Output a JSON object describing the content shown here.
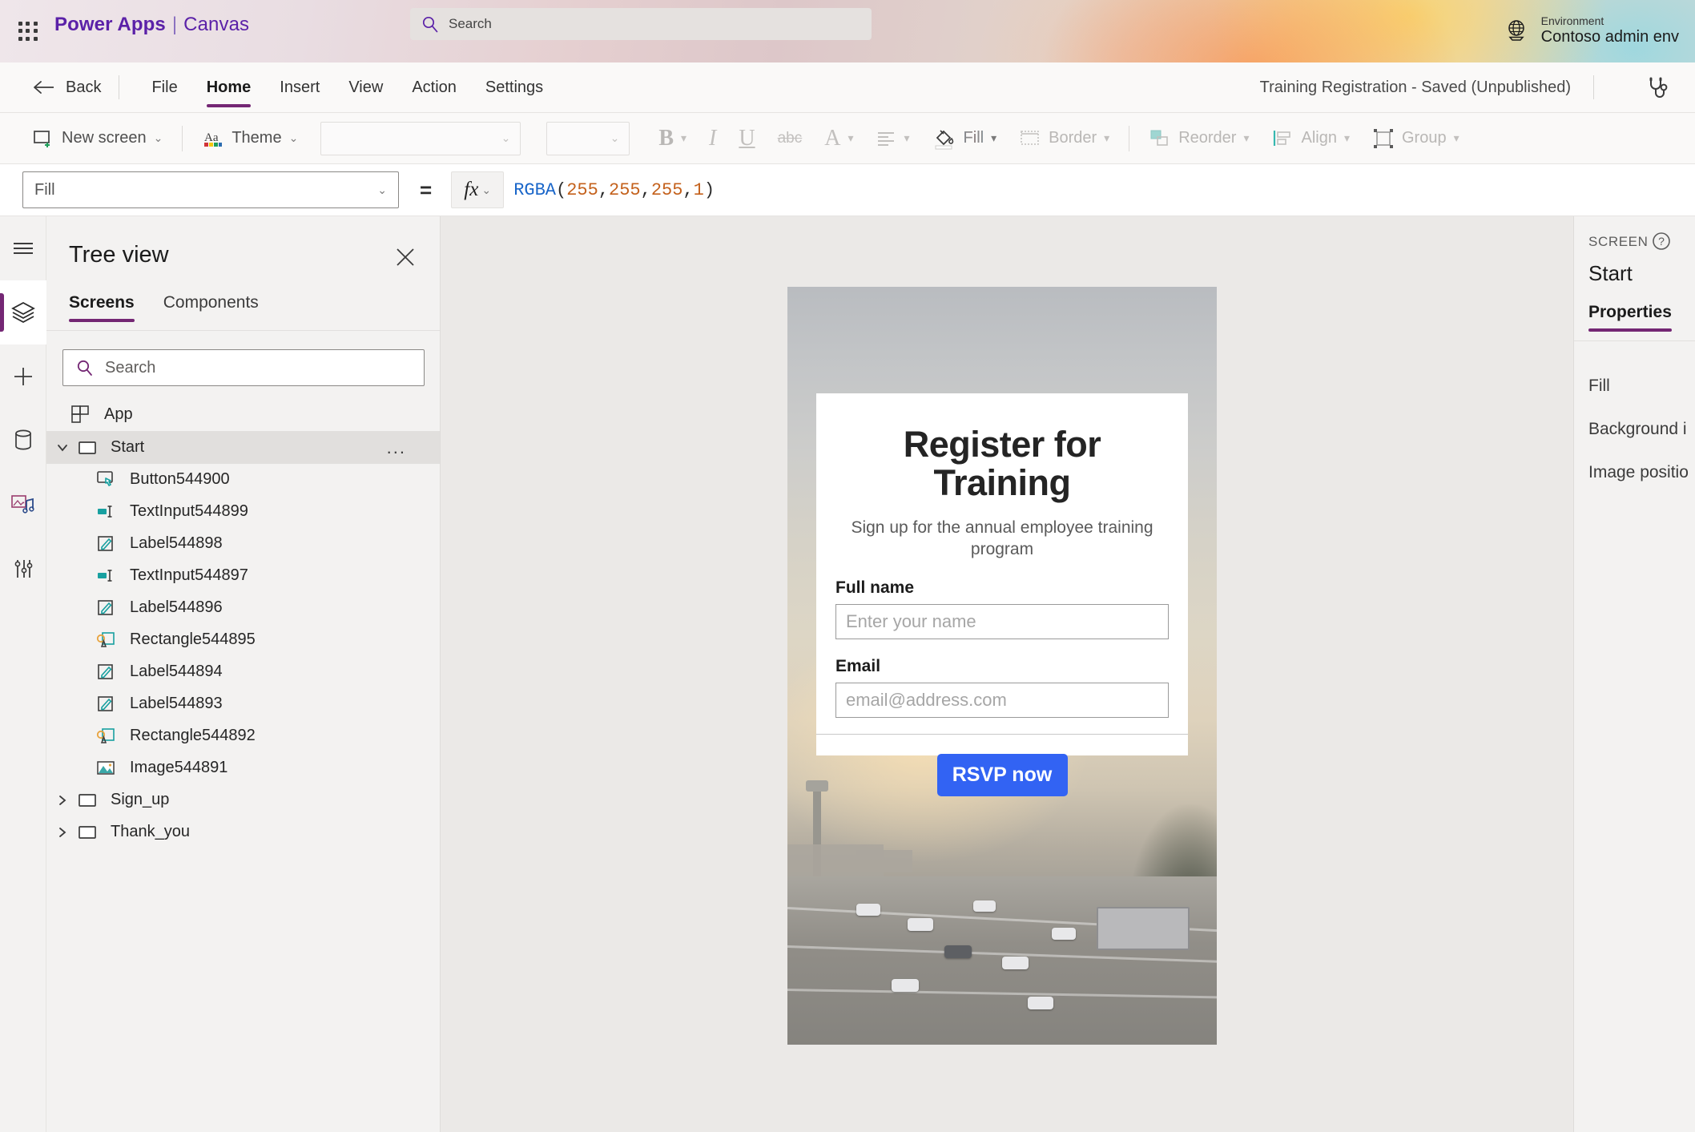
{
  "header": {
    "waffle_icon": "app-launcher-icon",
    "brand": "Power Apps",
    "brand_separator": "|",
    "brand_sub": "Canvas",
    "search": {
      "icon": "search-icon",
      "placeholder": "Search",
      "value": ""
    },
    "environment": {
      "icon": "globe-icon",
      "label": "Environment",
      "value": "Contoso admin env"
    }
  },
  "menubar": {
    "back": {
      "icon": "arrow-left-icon",
      "label": "Back"
    },
    "items": [
      {
        "label": "File",
        "active": false
      },
      {
        "label": "Home",
        "active": true
      },
      {
        "label": "Insert",
        "active": false
      },
      {
        "label": "View",
        "active": false
      },
      {
        "label": "Action",
        "active": false
      },
      {
        "label": "Settings",
        "active": false
      }
    ],
    "app_status": "Training Registration - Saved (Unpublished)",
    "health_icon": "stethoscope-icon"
  },
  "ribbon": {
    "new_screen": {
      "icon": "new-screen-icon",
      "label": "New screen",
      "chevron": "⌄"
    },
    "theme": {
      "icon": "theme-aa-icon",
      "label": "Theme",
      "chevron": "⌄"
    },
    "font_family": {
      "value": "",
      "chevron": "⌄"
    },
    "font_size": {
      "value": "",
      "chevron": "⌄"
    },
    "bold": {
      "icon": "bold-icon",
      "label": "B"
    },
    "italic": {
      "icon": "italic-icon",
      "label": "I"
    },
    "underline": {
      "icon": "underline-icon",
      "label": "U"
    },
    "strikethrough": {
      "icon": "strikethrough-icon",
      "label": "abc"
    },
    "font_color": {
      "icon": "font-color-icon",
      "label": "A"
    },
    "align": {
      "icon": "align-icon",
      "label": ""
    },
    "fill": {
      "icon": "fill-bucket-icon",
      "label": "Fill"
    },
    "border": {
      "icon": "border-icon",
      "label": "Border"
    },
    "reorder": {
      "icon": "reorder-icon",
      "label": "Reorder"
    },
    "align_tool": {
      "icon": "align-objects-icon",
      "label": "Align"
    },
    "group": {
      "icon": "group-icon",
      "label": "Group"
    }
  },
  "formula_bar": {
    "property_select": {
      "value": "Fill",
      "chevron": "⌄"
    },
    "equals": "=",
    "fx": {
      "icon": "fx-icon",
      "label": "fx",
      "chevron": "⌄"
    },
    "formula_tokens": [
      {
        "text": "RGBA",
        "kind": "fn"
      },
      {
        "text": "(",
        "kind": "pn"
      },
      {
        "text": "255",
        "kind": "num"
      },
      {
        "text": ", ",
        "kind": "pn"
      },
      {
        "text": "255",
        "kind": "num"
      },
      {
        "text": ", ",
        "kind": "pn"
      },
      {
        "text": "255",
        "kind": "num"
      },
      {
        "text": ", ",
        "kind": "pn"
      },
      {
        "text": "1",
        "kind": "num"
      },
      {
        "text": ")",
        "kind": "pn"
      }
    ],
    "formula_text": "RGBA(255, 255, 255, 1)"
  },
  "rail": {
    "items": [
      {
        "icon": "hamburger-menu-icon",
        "selected": false
      },
      {
        "icon": "layers-tree-view-icon",
        "selected": true
      },
      {
        "icon": "plus-insert-icon",
        "selected": false
      },
      {
        "icon": "database-data-icon",
        "selected": false
      },
      {
        "icon": "media-icon",
        "selected": false
      },
      {
        "icon": "advanced-settings-icon",
        "selected": false
      }
    ]
  },
  "tree_view": {
    "title": "Tree view",
    "close_icon": "close-icon",
    "tabs": [
      {
        "label": "Screens",
        "active": true
      },
      {
        "label": "Components",
        "active": false
      }
    ],
    "search": {
      "icon": "search-icon",
      "placeholder": "Search",
      "value": ""
    },
    "nodes": [
      {
        "label": "App",
        "icon": "app-node-icon",
        "indent": 1,
        "expander": "none",
        "selected": false,
        "menu": false
      },
      {
        "label": "Start",
        "icon": "screen-icon",
        "indent": 0,
        "expander": "expanded",
        "selected": true,
        "menu": true,
        "menu_label": "..."
      },
      {
        "label": "Button544900",
        "icon": "button-control-icon",
        "indent": 2,
        "expander": "none",
        "selected": false,
        "menu": false
      },
      {
        "label": "TextInput544899",
        "icon": "text-input-control-icon",
        "indent": 2,
        "expander": "none",
        "selected": false,
        "menu": false
      },
      {
        "label": "Label544898",
        "icon": "label-control-icon",
        "indent": 2,
        "expander": "none",
        "selected": false,
        "menu": false
      },
      {
        "label": "TextInput544897",
        "icon": "text-input-control-icon",
        "indent": 2,
        "expander": "none",
        "selected": false,
        "menu": false
      },
      {
        "label": "Label544896",
        "icon": "label-control-icon",
        "indent": 2,
        "expander": "none",
        "selected": false,
        "menu": false
      },
      {
        "label": "Rectangle544895",
        "icon": "shape-control-icon",
        "indent": 2,
        "expander": "none",
        "selected": false,
        "menu": false
      },
      {
        "label": "Label544894",
        "icon": "label-control-icon",
        "indent": 2,
        "expander": "none",
        "selected": false,
        "menu": false
      },
      {
        "label": "Label544893",
        "icon": "label-control-icon",
        "indent": 2,
        "expander": "none",
        "selected": false,
        "menu": false
      },
      {
        "label": "Rectangle544892",
        "icon": "shape-control-icon",
        "indent": 2,
        "expander": "none",
        "selected": false,
        "menu": false
      },
      {
        "label": "Image544891",
        "icon": "image-control-icon",
        "indent": 2,
        "expander": "none",
        "selected": false,
        "menu": false
      },
      {
        "label": "Sign_up",
        "icon": "screen-icon",
        "indent": 0,
        "expander": "collapsed",
        "selected": false,
        "menu": false
      },
      {
        "label": "Thank_you",
        "icon": "screen-icon",
        "indent": 0,
        "expander": "collapsed",
        "selected": false,
        "menu": false
      }
    ]
  },
  "app_preview": {
    "title": "Register for Training",
    "subtitle": "Sign up for the annual employee training program",
    "fields": [
      {
        "label": "Full name",
        "placeholder": "Enter your name",
        "value": ""
      },
      {
        "label": "Email",
        "placeholder": "email@address.com",
        "value": ""
      }
    ],
    "submit_button": {
      "label": "RSVP now",
      "color": "#3263f3",
      "text_color": "#ffffff"
    }
  },
  "properties_panel": {
    "kind": "SCREEN",
    "help_icon": "help-circle-icon",
    "name": "Start",
    "tabs": [
      {
        "label": "Properties",
        "active": true
      }
    ],
    "rows": [
      {
        "label": "Fill"
      },
      {
        "label": "Background i"
      },
      {
        "label": "Image positio"
      }
    ]
  },
  "colors": {
    "accent_purple": "#742774",
    "brand_purple": "#5b21a8",
    "button_blue": "#3263f3",
    "panel_bg": "#f3f2f1",
    "canvas_bg": "#ebe9e7"
  }
}
